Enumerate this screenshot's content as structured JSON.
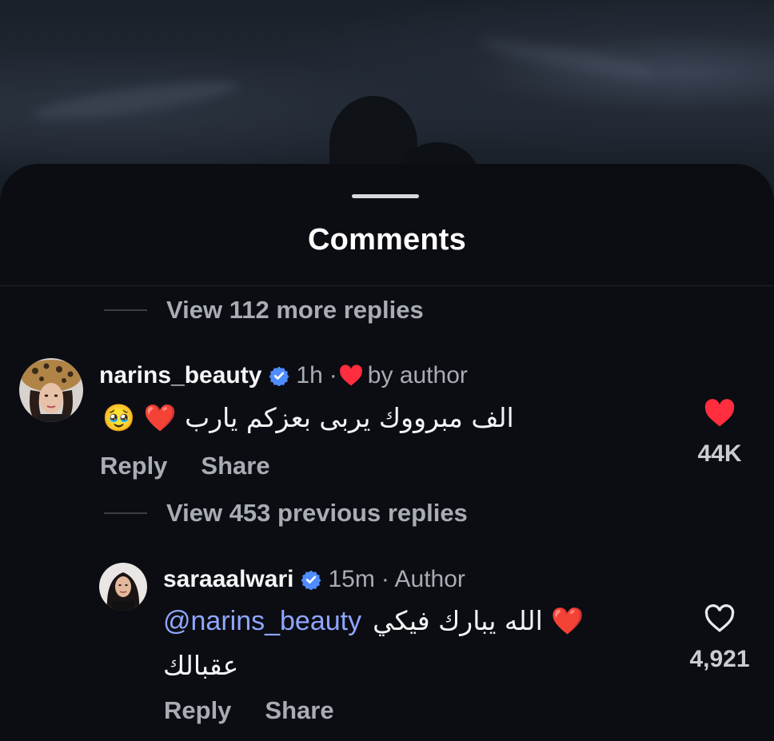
{
  "sheet": {
    "title": "Comments"
  },
  "thread": {
    "more_replies_label": "View 112 more replies",
    "previous_replies_label": "View 453 previous replies"
  },
  "comments": [
    {
      "username": "narins_beauty",
      "verified": true,
      "time": "1h",
      "separator": "·",
      "liked_by": "by author",
      "text": "الف مبرووك يربى بعزكم يارب ❤️ 🥹",
      "reply_label": "Reply",
      "share_label": "Share",
      "like_count": "44K",
      "liked": true
    },
    {
      "username": "saraaalwari",
      "verified": true,
      "time": "15m",
      "tag": "· Author",
      "mention": "@narins_beauty",
      "text_line1": "❤️ الله يبارك فيكي",
      "text_line2": "عقبالك",
      "reply_label": "Reply",
      "share_label": "Share",
      "like_count": "4,921",
      "liked": false
    }
  ],
  "colors": {
    "background": "#0b0d12",
    "heart_red": "#ff2d3d",
    "verified_blue": "#4f8cff",
    "mention_blue": "#8fa6ff",
    "muted_text": "#a8acb4"
  }
}
